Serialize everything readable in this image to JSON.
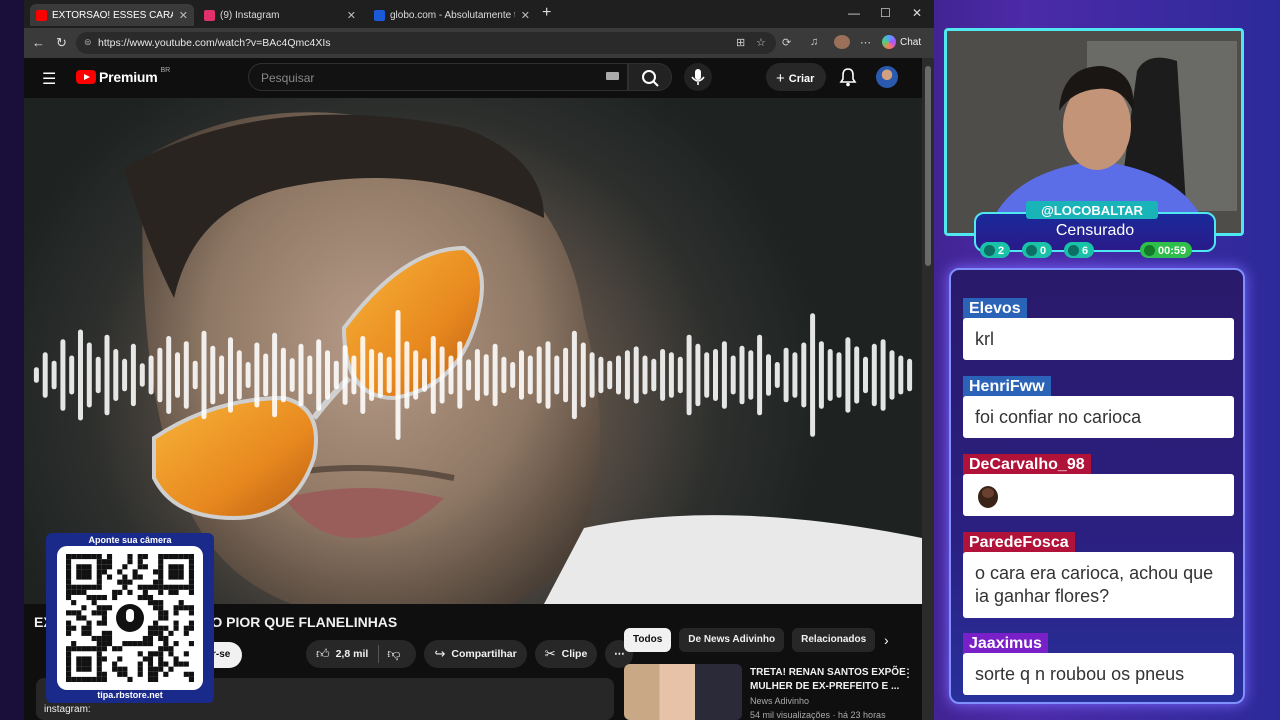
{
  "browser": {
    "tabs": [
      {
        "label": "EXTORSÃO! ESSES CARAS TÃO PIOR",
        "color": "#ff0000",
        "active": true
      },
      {
        "label": "(9) Instagram",
        "color": "#e1306c",
        "active": false
      },
      {
        "label": "globo.com - Absolutamente tudo",
        "color": "#1a5ad8",
        "active": false
      }
    ],
    "url": "https://www.youtube.com/watch?v=BAc4Qmc4XIs",
    "chat_label": "Chat"
  },
  "youtube": {
    "logo_text": "Premium",
    "logo_region": "BR",
    "search_placeholder": "Pesquisar",
    "create_label": "Criar",
    "video_title": "EXTORSÃO! ESSES CARAS TÃO PIOR QUE FLANELINHAS",
    "title_visible_start": "EX",
    "title_visible_end": "TÃO PIOR QUE FLANELINHAS",
    "subscribe_partial": "r-se",
    "likes": "2,8 mil",
    "share_label": "Compartilhar",
    "clip_label": "Clipe",
    "chips": [
      "Todos",
      "De News Adivinho",
      "Relacionados"
    ],
    "description_line2": "instagram:",
    "recommendation": {
      "title": "TRETA! RENAN SANTOS EXPÕE MULHER DE EX-PREFEITO E ...",
      "channel": "News Adivinho",
      "views": "54 mil visualizações · há 23 horas"
    }
  },
  "audio_wave": [
    0.12,
    0.35,
    0.22,
    0.55,
    0.3,
    0.7,
    0.5,
    0.28,
    0.62,
    0.4,
    0.25,
    0.48,
    0.18,
    0.3,
    0.42,
    0.6,
    0.35,
    0.52,
    0.22,
    0.68,
    0.45,
    0.3,
    0.58,
    0.38,
    0.2,
    0.5,
    0.33,
    0.65,
    0.42,
    0.26,
    0.48,
    0.3,
    0.55,
    0.38,
    0.22,
    0.46,
    0.3,
    0.6,
    0.4,
    0.35,
    0.28,
    1.0,
    0.52,
    0.38,
    0.26,
    0.6,
    0.44,
    0.3,
    0.52,
    0.24,
    0.4,
    0.32,
    0.48,
    0.28,
    0.2,
    0.38,
    0.3,
    0.44,
    0.52,
    0.3,
    0.42,
    0.68,
    0.5,
    0.35,
    0.28,
    0.22,
    0.3,
    0.38,
    0.44,
    0.3,
    0.25,
    0.4,
    0.35,
    0.28,
    0.62,
    0.48,
    0.35,
    0.4,
    0.52,
    0.3,
    0.45,
    0.38,
    0.62,
    0.32,
    0.2,
    0.42,
    0.35,
    0.5,
    0.95,
    0.52,
    0.4,
    0.35,
    0.58,
    0.44,
    0.28,
    0.48,
    0.55,
    0.38,
    0.3,
    0.25
  ],
  "qr": {
    "top_text": "Aponte sua câmera",
    "bottom_text": "tipa.rbstore.net"
  },
  "stream": {
    "handle": "@LOCOBALTAR",
    "status": "Censurado",
    "twitch_count": "2",
    "youtube_count": "0",
    "kick_count": "6",
    "timer": "00:59"
  },
  "chat": {
    "messages": [
      {
        "user": "Elevos",
        "color": "#2a63b8",
        "text": "krl"
      },
      {
        "user": "HenriFww",
        "color": "#2a63b8",
        "text": "foi confiar no carioca"
      },
      {
        "user": "DeCarvalho_98",
        "color": "#b0123a",
        "text": ""
      },
      {
        "user": "ParedeFosca",
        "color": "#b0123a",
        "text": "o cara era carioca, achou que ia ganhar flores?"
      },
      {
        "user": "Jaaximus",
        "color": "#7a20c8",
        "text": "sorte q n roubou os pneus"
      }
    ]
  }
}
